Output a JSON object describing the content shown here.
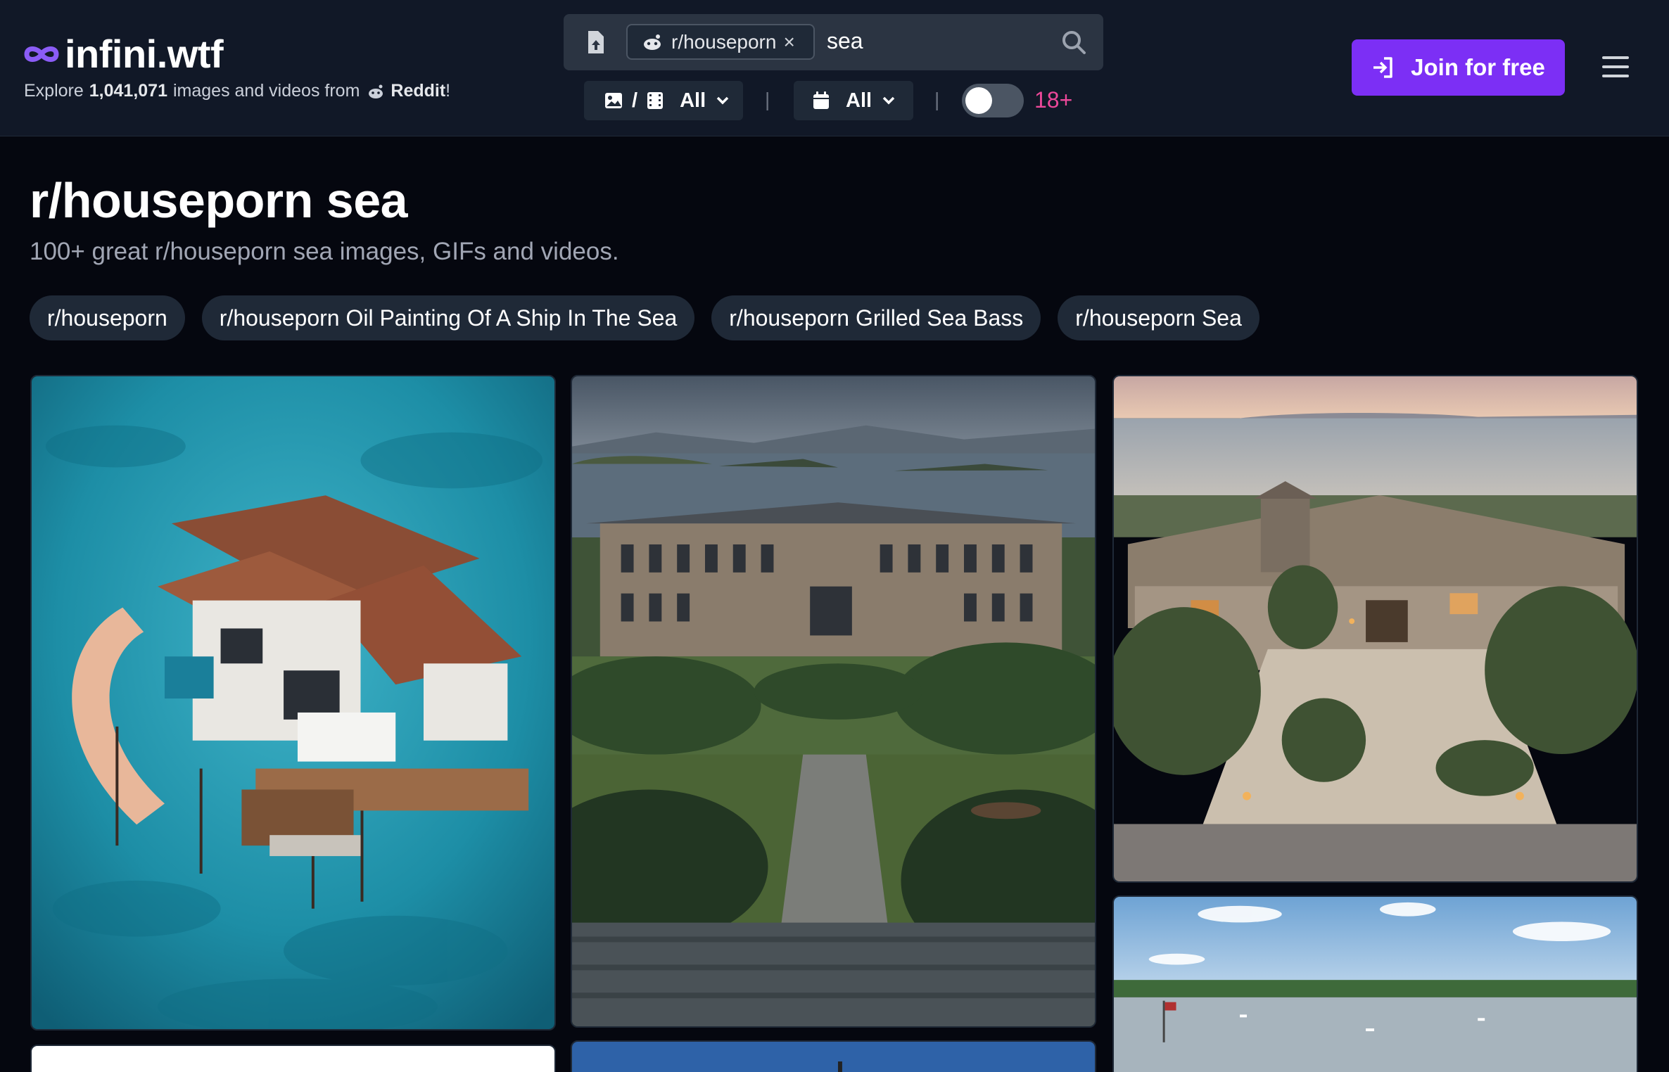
{
  "brand": {
    "name": "infini.wtf",
    "tagline_prefix": "Explore",
    "image_count": "1,041,071",
    "tagline_mid": "images and videos from",
    "source": "Reddit",
    "tagline_suffix": "!"
  },
  "search": {
    "subreddit_chip": "r/houseporn",
    "chip_remove": "×",
    "query": "sea"
  },
  "filters": {
    "media_separator": "/",
    "media_value": "All",
    "divider": "|",
    "date_value": "All",
    "nsfw_label": "18+",
    "nsfw_enabled": false
  },
  "header": {
    "join_label": "Join for free"
  },
  "page": {
    "title": "r/houseporn sea",
    "subtitle": "100+ great r/houseporn sea images, GIFs and videos."
  },
  "related_tags": [
    "r/houseporn",
    "r/houseporn Oil Painting Of A Ship In The Sea",
    "r/houseporn Grilled Sea Bass",
    "r/houseporn Sea"
  ],
  "colors": {
    "accent": "#7c2ff5",
    "nsfw": "#ec4899",
    "background": "#05070f",
    "header": "#111827"
  },
  "icons": {
    "logo": "infinity-icon",
    "reddit": "reddit-icon",
    "upload": "file-upload-icon",
    "search": "search-icon",
    "media": "image-video-icon",
    "date": "calendar-icon",
    "join": "login-icon",
    "menu": "hamburger-menu-icon"
  }
}
